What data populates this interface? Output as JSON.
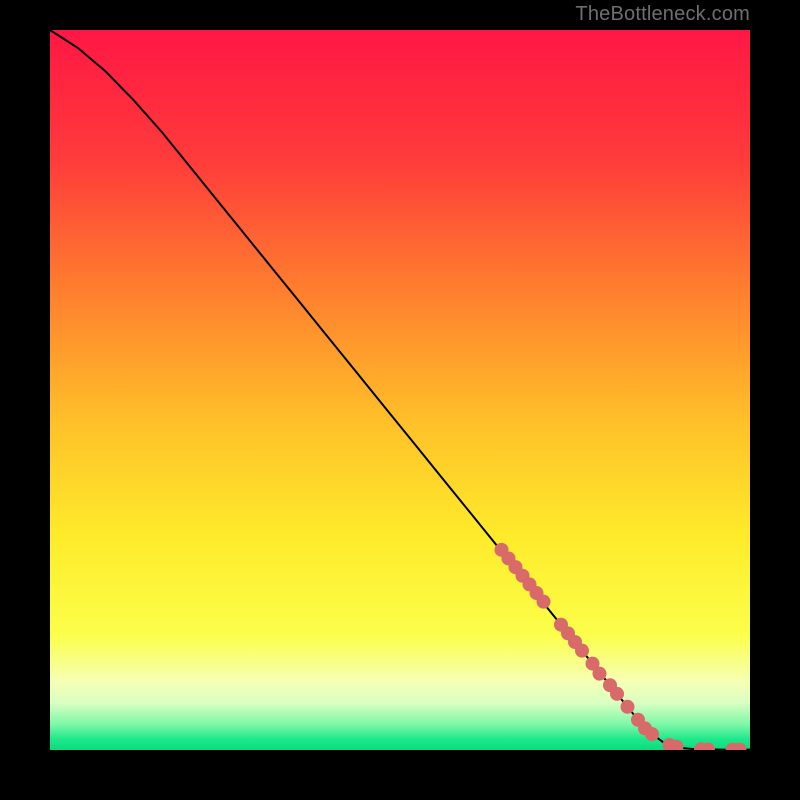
{
  "watermark": "TheBottleneck.com",
  "chart_data": {
    "type": "line",
    "title": "",
    "xlabel": "",
    "ylabel": "",
    "xlim": [
      0,
      100
    ],
    "ylim": [
      0,
      100
    ],
    "series": [
      {
        "name": "curve",
        "x": [
          0,
          4,
          8,
          12,
          16,
          20,
          24,
          28,
          32,
          36,
          40,
          44,
          48,
          52,
          56,
          60,
          64,
          68,
          72,
          76,
          80,
          84,
          86,
          88,
          90,
          92,
          94,
          96,
          98,
          100
        ],
        "y": [
          100,
          97.5,
          94.2,
          90.2,
          85.8,
          81,
          76.2,
          71.4,
          66.6,
          61.8,
          57,
          52.2,
          47.4,
          42.6,
          37.8,
          33,
          28.2,
          23.4,
          18.6,
          13.8,
          9,
          4.2,
          2.2,
          0.8,
          0.3,
          0.13,
          0.08,
          0.06,
          0.06,
          0.06
        ]
      }
    ],
    "markers": [
      {
        "x": 64.5,
        "y": 27.8
      },
      {
        "x": 65.5,
        "y": 26.6
      },
      {
        "x": 66.5,
        "y": 25.4
      },
      {
        "x": 67.5,
        "y": 24.2
      },
      {
        "x": 68.5,
        "y": 23.0
      },
      {
        "x": 69.5,
        "y": 21.8
      },
      {
        "x": 70.5,
        "y": 20.6
      },
      {
        "x": 73.0,
        "y": 17.4
      },
      {
        "x": 74.0,
        "y": 16.2
      },
      {
        "x": 75.0,
        "y": 15.0
      },
      {
        "x": 76.0,
        "y": 13.8
      },
      {
        "x": 77.5,
        "y": 12.0
      },
      {
        "x": 78.5,
        "y": 10.6
      },
      {
        "x": 80.0,
        "y": 9.0
      },
      {
        "x": 81.0,
        "y": 7.8
      },
      {
        "x": 82.5,
        "y": 6.0
      },
      {
        "x": 84.0,
        "y": 4.2
      },
      {
        "x": 85.0,
        "y": 3.0
      },
      {
        "x": 86.0,
        "y": 2.2
      },
      {
        "x": 88.5,
        "y": 0.7
      },
      {
        "x": 89.5,
        "y": 0.45
      },
      {
        "x": 93.0,
        "y": 0.1
      },
      {
        "x": 94.0,
        "y": 0.08
      },
      {
        "x": 97.5,
        "y": 0.06
      },
      {
        "x": 98.5,
        "y": 0.06
      }
    ],
    "gradient_stops": [
      {
        "offset": 0.0,
        "color": "#ff1744"
      },
      {
        "offset": 0.18,
        "color": "#ff3b3b"
      },
      {
        "offset": 0.35,
        "color": "#ff7a2f"
      },
      {
        "offset": 0.55,
        "color": "#ffc229"
      },
      {
        "offset": 0.7,
        "color": "#feea2a"
      },
      {
        "offset": 0.84,
        "color": "#fbff4a"
      },
      {
        "offset": 0.905,
        "color": "#f6ffb5"
      },
      {
        "offset": 0.935,
        "color": "#d8ffc2"
      },
      {
        "offset": 0.965,
        "color": "#7cf7a6"
      },
      {
        "offset": 0.985,
        "color": "#1de98b"
      },
      {
        "offset": 1.0,
        "color": "#0bdc7e"
      }
    ],
    "marker_color": "#d86a6a",
    "line_color": "#000000"
  }
}
